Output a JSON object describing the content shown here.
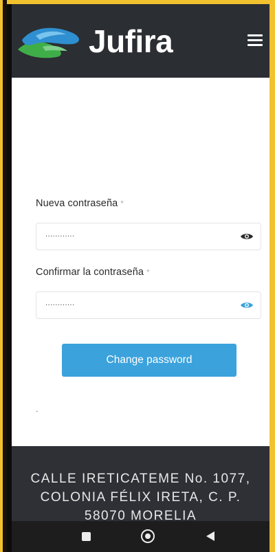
{
  "header": {
    "brand": "Jufira",
    "logo_icon": "hands-logo-icon",
    "menu_icon": "hamburger-menu-icon"
  },
  "form": {
    "new_password": {
      "label": "Nueva contraseña",
      "required_mark": "*",
      "masked_value": "............",
      "eye_icon": "eye-icon"
    },
    "confirm_password": {
      "label": "Confirmar la contraseña",
      "required_mark": "*",
      "masked_value": "............",
      "eye_icon": "eye-icon"
    },
    "submit_label": "Change password",
    "trailing_text": "."
  },
  "footer": {
    "address_line1": "CALLE IRETICATEME No. 1077,",
    "address_line2": "COLONIA FÉLIX IRETA, C. P.",
    "address_line3": "58070 MORELIA"
  },
  "navbar": {
    "recents_icon": "square-recents-icon",
    "home_icon": "circle-home-icon",
    "back_icon": "triangle-back-icon"
  },
  "colors": {
    "header_bg": "#2b2e33",
    "accent": "#3ba2dc",
    "footer_bg": "#2e3035",
    "frame": "#f2c12e"
  }
}
